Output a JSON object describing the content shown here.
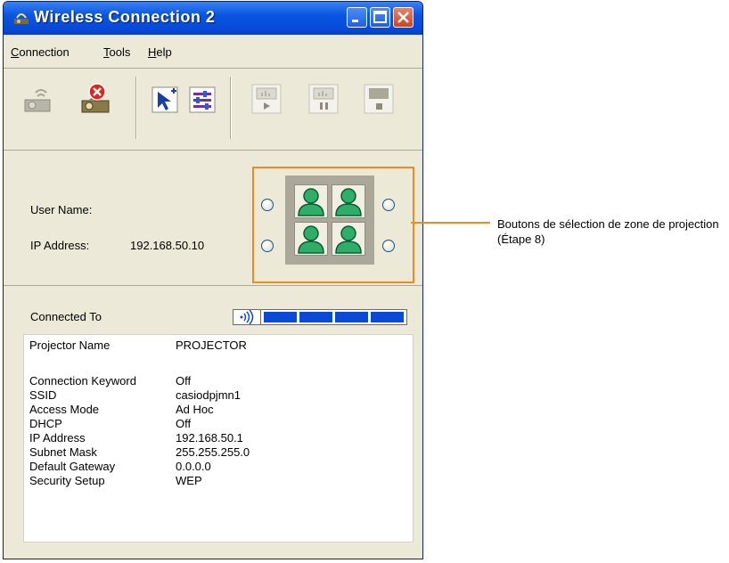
{
  "window": {
    "title": "Wireless Connection 2"
  },
  "menu": {
    "connection": "onnection",
    "connection_key": "C",
    "tools": "ools",
    "tools_key": "T",
    "help": "elp",
    "help_key": "H"
  },
  "toolbar": {
    "tools": [
      "connect-projector-icon",
      "disconnect-projector-icon",
      "pointer-add-icon",
      "settings-sliders-icon",
      "play-icon",
      "pause-icon",
      "stop-icon"
    ]
  },
  "user": {
    "name_label": "User Name:",
    "ip_label": "IP Address:",
    "ip_value": "192.168.50.10"
  },
  "connected_to": {
    "label": "Connected To",
    "signal_level": 4
  },
  "info": [
    {
      "key": "Projector Name",
      "value": "PROJECTOR"
    },
    {
      "key": "Connection Keyword",
      "value": "Off"
    },
    {
      "key": "SSID",
      "value": "casiodpjmn1"
    },
    {
      "key": "Access Mode",
      "value": "Ad Hoc"
    },
    {
      "key": "DHCP",
      "value": "Off"
    },
    {
      "key": "IP Address",
      "value": "192.168.50.1"
    },
    {
      "key": "Subnet Mask",
      "value": "255.255.255.0"
    },
    {
      "key": "Default Gateway",
      "value": "0.0.0.0"
    },
    {
      "key": "Security Setup",
      "value": "WEP"
    }
  ],
  "callout": {
    "text": "Boutons de sélection de zone de projection (Étape 8)"
  },
  "colors": {
    "accent": "#f08c1e",
    "title_blue": "#0b56e0",
    "face": "#ece9d8"
  }
}
